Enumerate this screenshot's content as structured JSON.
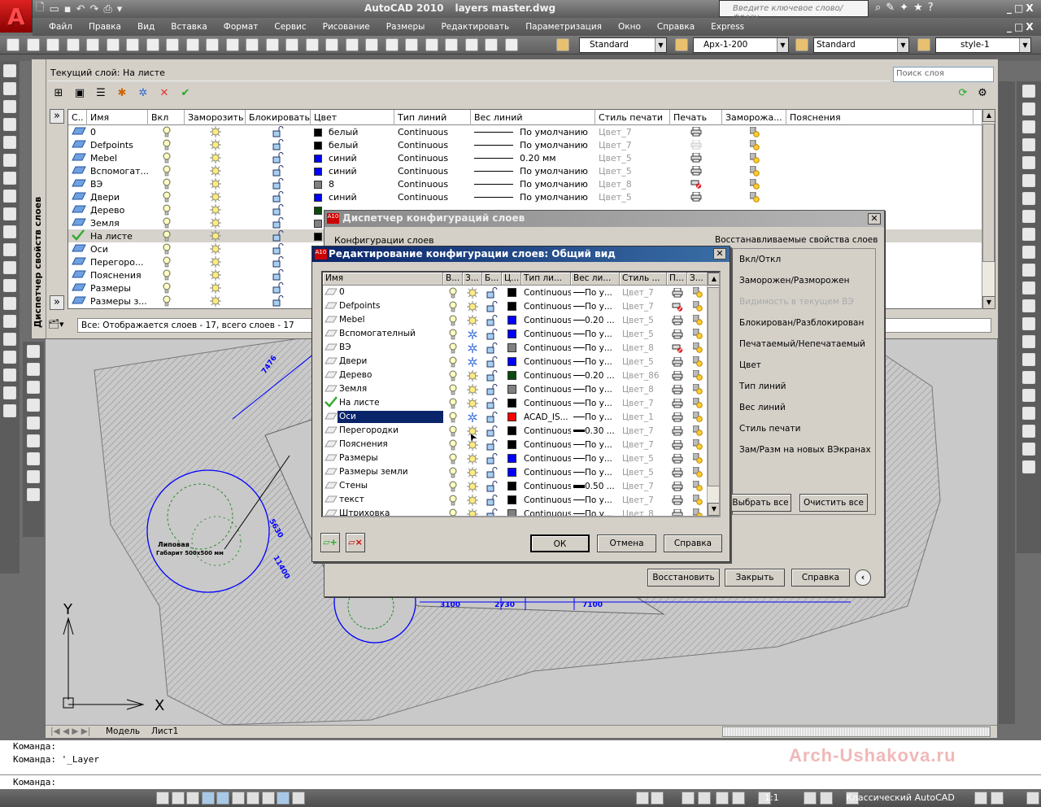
{
  "app": {
    "name": "AutoCAD 2010",
    "file": "layers master.dwg",
    "info_placeholder": "Введите ключевое слово/фразу"
  },
  "menu": [
    "Файл",
    "Правка",
    "Вид",
    "Вставка",
    "Формат",
    "Сервис",
    "Рисование",
    "Размеры",
    "Редактировать",
    "Параметризация",
    "Окно",
    "Справка",
    "Express"
  ],
  "toolbar": {
    "text_style": "Standard",
    "dim_style": "Арх-1-200",
    "table_style": "Standard",
    "mleader_style": "style-1"
  },
  "palette": {
    "title": "Диспетчер свойств слоев",
    "current_layer": "Текущий слой: На листе",
    "search_placeholder": "Поиск слоя",
    "status": "Все: Отображается слоев - 17, всего слоев - 17",
    "columns": [
      "С..",
      "Имя",
      "Вкл",
      "Заморозить",
      "Блокировать",
      "Цвет",
      "Тип линий",
      "Вес линий",
      "Стиль печати",
      "Печать",
      "Заморожа...",
      "Пояснения"
    ],
    "layers": [
      {
        "name": "0",
        "color_name": "белый",
        "color": "#000000",
        "linetype": "Continuous",
        "weight": "По умолчанию",
        "style": "Цвет_7",
        "print": "on"
      },
      {
        "name": "Defpoints",
        "color_name": "белый",
        "color": "#000000",
        "linetype": "Continuous",
        "weight": "По умолчанию",
        "style": "Цвет_7",
        "print": "disabled"
      },
      {
        "name": "Mebel",
        "color_name": "синий",
        "color": "#0000ff",
        "linetype": "Continuous",
        "weight": "0.20 мм",
        "style": "Цвет_5",
        "print": "on"
      },
      {
        "name": "Вспомогат...",
        "color_name": "синий",
        "color": "#0000ff",
        "linetype": "Continuous",
        "weight": "По умолчанию",
        "style": "Цвет_5",
        "print": "on"
      },
      {
        "name": "ВЭ",
        "color_name": "8",
        "color": "#808080",
        "linetype": "Continuous",
        "weight": "По умолчанию",
        "style": "Цвет_8",
        "print": "off"
      },
      {
        "name": "Двери",
        "color_name": "синий",
        "color": "#0000ff",
        "linetype": "Continuous",
        "weight": "По умолчанию",
        "style": "Цвет_5",
        "print": "on"
      },
      {
        "name": "Дерево",
        "color": "#0a4a0a"
      },
      {
        "name": "Земля",
        "color": "#808080"
      },
      {
        "name": "На листе",
        "color": "#000000",
        "current": true
      },
      {
        "name": "Оси",
        "color": "#ff0000"
      },
      {
        "name": "Перегоро...",
        "color": "#000000"
      },
      {
        "name": "Пояснения",
        "color": "#000000"
      },
      {
        "name": "Размеры",
        "color": "#0000ff"
      },
      {
        "name": "Размеры з...",
        "color": "#0000ff"
      }
    ]
  },
  "config_manager": {
    "title": "Диспетчер конфигураций слоев",
    "list_label": "Конфигурации слоев",
    "restore_label": "Восстанавливаемые свойства слоев",
    "properties": [
      {
        "label": "Вкл/Откл",
        "enabled": true
      },
      {
        "label": "Заморожен/Разморожен",
        "enabled": true
      },
      {
        "label": "Видимость в текущем ВЭ",
        "enabled": false
      },
      {
        "label": "Блокирован/Разблокирован",
        "enabled": true
      },
      {
        "label": "Печатаемый/Непечатаемый",
        "enabled": true
      },
      {
        "label": "Цвет",
        "enabled": true
      },
      {
        "label": "Тип линий",
        "enabled": true
      },
      {
        "label": "Вес линий",
        "enabled": true
      },
      {
        "label": "Стиль печати",
        "enabled": true
      },
      {
        "label": "Зам/Разм на новых ВЭкранах",
        "enabled": true
      }
    ],
    "select_all": "Выбрать все",
    "clear_all": "Очистить все",
    "restore": "Восстановить",
    "close": "Закрыть",
    "help": "Справка"
  },
  "edit_dialog": {
    "title": "Редактирование конфигурации слоев: Общий вид",
    "columns": [
      "Имя",
      "В...",
      "З...",
      "Б...",
      "Ц...",
      "Тип ли...",
      "Вес ли...",
      "Стиль ...",
      "П...",
      "З..."
    ],
    "ok": "ОК",
    "cancel": "Отмена",
    "help": "Справка",
    "layers": [
      {
        "name": "0",
        "frozen": false,
        "color": "#000000",
        "linetype": "Continuous",
        "weight": "По у...",
        "w": 1,
        "style": "Цвет_7",
        "print": "on"
      },
      {
        "name": "Defpoints",
        "frozen": false,
        "color": "#000000",
        "linetype": "Continuous",
        "weight": "По у...",
        "w": 1,
        "style": "Цвет_7",
        "print": "off"
      },
      {
        "name": "Mebel",
        "frozen": false,
        "color": "#0000ff",
        "linetype": "Continuous",
        "weight": "0.20 ...",
        "w": 1,
        "style": "Цвет_5",
        "print": "on"
      },
      {
        "name": "Вспомогателный",
        "frozen": true,
        "color": "#0000ff",
        "linetype": "Continuous",
        "weight": "По у...",
        "w": 1,
        "style": "Цвет_5",
        "print": "on"
      },
      {
        "name": "ВЭ",
        "frozen": true,
        "color": "#808080",
        "linetype": "Continuous",
        "weight": "По у...",
        "w": 1,
        "style": "Цвет_8",
        "print": "off"
      },
      {
        "name": "Двери",
        "frozen": true,
        "color": "#0000ff",
        "linetype": "Continuous",
        "weight": "По у...",
        "w": 1,
        "style": "Цвет_5",
        "print": "on"
      },
      {
        "name": "Дерево",
        "frozen": false,
        "color": "#0a4a0a",
        "linetype": "Continuous",
        "weight": "0.20 ...",
        "w": 1,
        "style": "Цвет_86",
        "print": "on"
      },
      {
        "name": "Земля",
        "frozen": false,
        "color": "#808080",
        "linetype": "Continuous",
        "weight": "По у...",
        "w": 1,
        "style": "Цвет_8",
        "print": "on"
      },
      {
        "name": "На листе",
        "frozen": false,
        "color": "#000000",
        "linetype": "Continuous",
        "weight": "По у...",
        "w": 1,
        "style": "Цвет_7",
        "print": "on",
        "current": true
      },
      {
        "name": "Оси",
        "frozen": true,
        "color": "#ff0000",
        "linetype": "ACAD_IS...",
        "weight": "По у...",
        "w": 1,
        "style": "Цвет_1",
        "print": "on",
        "selected": true
      },
      {
        "name": "Перегородки",
        "frozen": false,
        "color": "#000000",
        "linetype": "Continuous",
        "weight": "0.30 ...",
        "w": 3,
        "style": "Цвет_7",
        "print": "on"
      },
      {
        "name": "Пояснения",
        "frozen": false,
        "color": "#000000",
        "linetype": "Continuous",
        "weight": "По у...",
        "w": 1,
        "style": "Цвет_7",
        "print": "on"
      },
      {
        "name": "Размеры",
        "frozen": false,
        "color": "#0000ff",
        "linetype": "Continuous",
        "weight": "По у...",
        "w": 1,
        "style": "Цвет_5",
        "print": "on"
      },
      {
        "name": "Размеры земли",
        "frozen": false,
        "color": "#0000ff",
        "linetype": "Continuous",
        "weight": "По у...",
        "w": 1,
        "style": "Цвет_5",
        "print": "on"
      },
      {
        "name": "Стены",
        "frozen": false,
        "color": "#000000",
        "linetype": "Continuous",
        "weight": "0.50 ...",
        "w": 4,
        "style": "Цвет_7",
        "print": "on"
      },
      {
        "name": "текст",
        "frozen": false,
        "color": "#000000",
        "linetype": "Continuous",
        "weight": "По у...",
        "w": 1,
        "style": "Цвет_7",
        "print": "on"
      },
      {
        "name": "Штриховка",
        "frozen": false,
        "color": "#808080",
        "linetype": "Continuous",
        "weight": "По у...",
        "w": 1,
        "style": "Цвет_8",
        "print": "on"
      }
    ]
  },
  "drawing": {
    "tree_label": "Липовая",
    "tree_note": "Габарит 500x500 мм",
    "dims": [
      "7476",
      "3100",
      "2730",
      "7100",
      "5630",
      "11400"
    ],
    "axis_x": "X",
    "axis_y": "Y"
  },
  "layout_tabs": [
    "Модель",
    "Лист1"
  ],
  "command": {
    "lines": [
      "Команда:",
      "Команда: '_Layer"
    ],
    "prompt": "Команда:"
  },
  "watermark": "Arch-Ushakova.ru",
  "statusbar": {
    "scale": "1:1",
    "workspace": "Классический AutoCAD"
  }
}
